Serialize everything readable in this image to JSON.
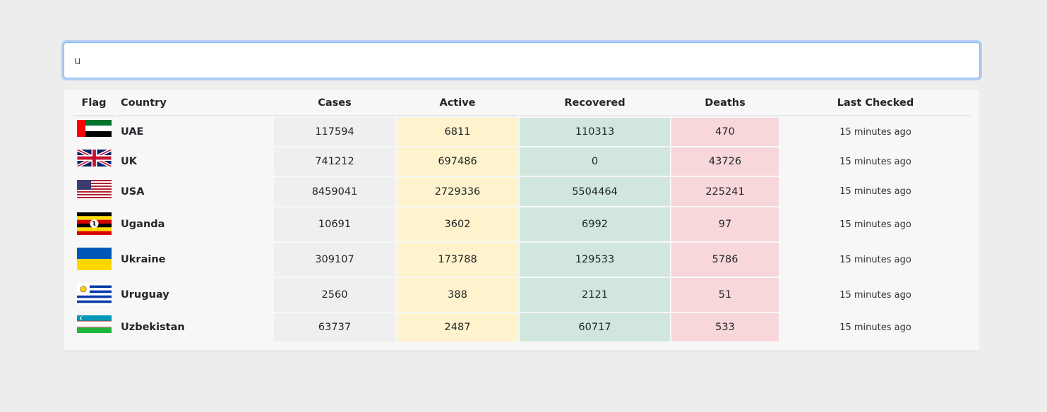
{
  "search": {
    "value": "u"
  },
  "table": {
    "headers": {
      "flag": "Flag",
      "country": "Country",
      "cases": "Cases",
      "active": "Active",
      "recovered": "Recovered",
      "deaths": "Deaths",
      "last_checked": "Last Checked"
    },
    "rows": [
      {
        "country": "UAE",
        "cases": "117594",
        "active": "6811",
        "recovered": "110313",
        "deaths": "470",
        "last_checked": "15 minutes ago",
        "flag_icon": "uae-flag-icon"
      },
      {
        "country": "UK",
        "cases": "741212",
        "active": "697486",
        "recovered": "0",
        "deaths": "43726",
        "last_checked": "15 minutes ago",
        "flag_icon": "uk-flag-icon"
      },
      {
        "country": "USA",
        "cases": "8459041",
        "active": "2729336",
        "recovered": "5504464",
        "deaths": "225241",
        "last_checked": "15 minutes ago",
        "flag_icon": "usa-flag-icon"
      },
      {
        "country": "Uganda",
        "cases": "10691",
        "active": "3602",
        "recovered": "6992",
        "deaths": "97",
        "last_checked": "15 minutes ago",
        "flag_icon": "uganda-flag-icon"
      },
      {
        "country": "Ukraine",
        "cases": "309107",
        "active": "173788",
        "recovered": "129533",
        "deaths": "5786",
        "last_checked": "15 minutes ago",
        "flag_icon": "ukraine-flag-icon"
      },
      {
        "country": "Uruguay",
        "cases": "2560",
        "active": "388",
        "recovered": "2121",
        "deaths": "51",
        "last_checked": "15 minutes ago",
        "flag_icon": "uruguay-flag-icon"
      },
      {
        "country": "Uzbekistan",
        "cases": "63737",
        "active": "2487",
        "recovered": "60717",
        "deaths": "533",
        "last_checked": "15 minutes ago",
        "flag_icon": "uzbekistan-flag-icon"
      }
    ]
  },
  "colors": {
    "cases_bg": "#efefef",
    "active_bg": "#fff3cd",
    "recovered_bg": "#d1e7dd",
    "deaths_bg": "#f8d7da",
    "focus_ring": "#86b7fe"
  }
}
